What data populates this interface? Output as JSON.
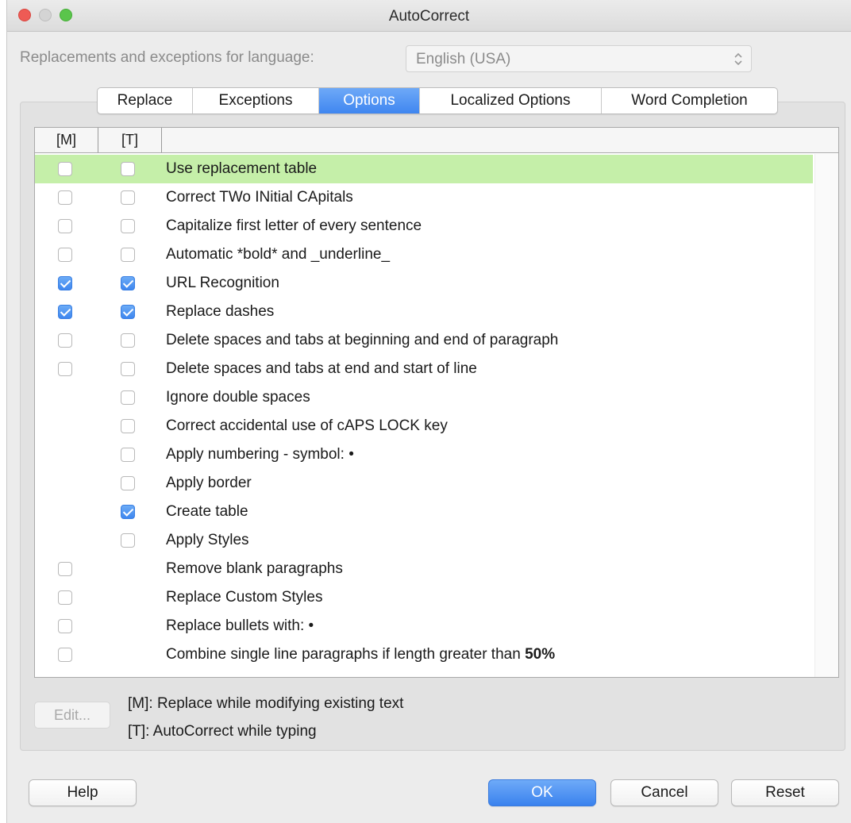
{
  "window": {
    "title": "AutoCorrect"
  },
  "language": {
    "label": "Replacements and exceptions for language:",
    "value": "English (USA)"
  },
  "tabs": [
    {
      "label": "Replace",
      "active": false
    },
    {
      "label": "Exceptions",
      "active": false
    },
    {
      "label": "Options",
      "active": true
    },
    {
      "label": "Localized Options",
      "active": false
    },
    {
      "label": "Word Completion",
      "active": false
    }
  ],
  "table": {
    "headers": {
      "m": "[M]",
      "t": "[T]",
      "desc": ""
    },
    "rows": [
      {
        "label": "Use replacement table",
        "m": false,
        "t": false,
        "selected": true
      },
      {
        "label": "Correct TWo INitial CApitals",
        "m": false,
        "t": false
      },
      {
        "label": "Capitalize first letter of every sentence",
        "m": false,
        "t": false
      },
      {
        "label": "Automatic *bold* and _underline_",
        "m": false,
        "t": false
      },
      {
        "label": "URL Recognition",
        "m": true,
        "t": true
      },
      {
        "label": "Replace dashes",
        "m": true,
        "t": true
      },
      {
        "label": "Delete spaces and tabs at beginning and end of paragraph",
        "m": false,
        "t": false
      },
      {
        "label": "Delete spaces and tabs at end and start of line",
        "m": false,
        "t": false
      },
      {
        "label": "Ignore double spaces",
        "m": null,
        "t": false
      },
      {
        "label": "Correct accidental use of cAPS LOCK key",
        "m": null,
        "t": false
      },
      {
        "label": "Apply numbering - symbol: •",
        "m": null,
        "t": false
      },
      {
        "label": "Apply border",
        "m": null,
        "t": false
      },
      {
        "label": "Create table",
        "m": null,
        "t": true
      },
      {
        "label": "Apply Styles",
        "m": null,
        "t": false
      },
      {
        "label": "Remove blank paragraphs",
        "m": false,
        "t": null
      },
      {
        "label": "Replace Custom Styles",
        "m": false,
        "t": null
      },
      {
        "label": "Replace bullets with: •",
        "m": false,
        "t": null
      },
      {
        "label": "Combine single line paragraphs if length greater than",
        "bold_suffix": "50%",
        "m": false,
        "t": null
      }
    ]
  },
  "edit_button": "Edit...",
  "legend": {
    "m": "[M]: Replace while modifying existing text",
    "t": "[T]: AutoCorrect while typing"
  },
  "buttons": {
    "help": "Help",
    "ok": "OK",
    "cancel": "Cancel",
    "reset": "Reset"
  },
  "icons": {
    "select_arrows": "up-down-chevron-icon",
    "checkbox_checked": "checkmark-icon"
  },
  "colors": {
    "accent": "#3f86f0",
    "selected_row": "#c5efa9"
  }
}
